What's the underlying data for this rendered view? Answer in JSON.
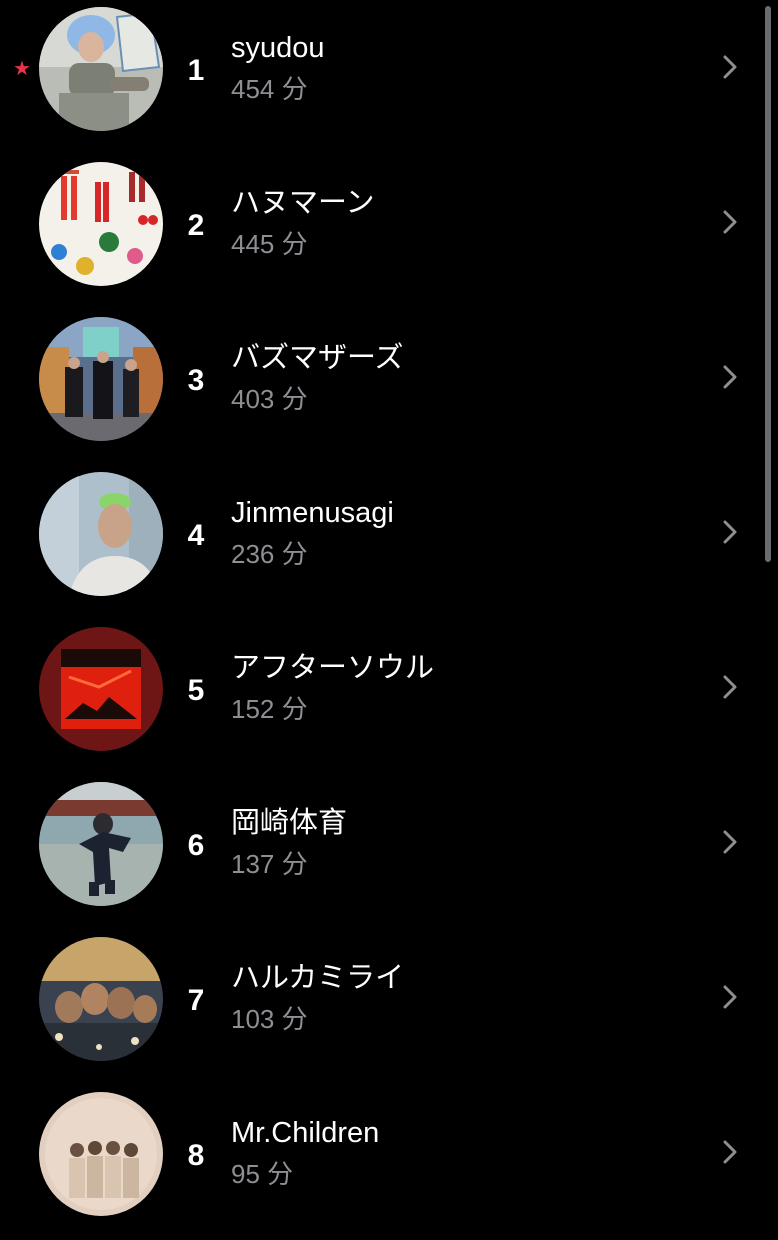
{
  "unit": "分",
  "highlight_color": "#e8334a",
  "rows": [
    {
      "rank": "1",
      "name": "syudou",
      "minutes": "454 分",
      "starred": true,
      "icon": "artist-avatar"
    },
    {
      "rank": "2",
      "name": "ハヌマーン",
      "minutes": "445 分",
      "starred": false,
      "icon": "artist-avatar"
    },
    {
      "rank": "3",
      "name": "バズマザーズ",
      "minutes": "403 分",
      "starred": false,
      "icon": "artist-avatar"
    },
    {
      "rank": "4",
      "name": "Jinmenusagi",
      "minutes": "236 分",
      "starred": false,
      "icon": "artist-avatar"
    },
    {
      "rank": "5",
      "name": "アフターソウル",
      "minutes": "152 分",
      "starred": false,
      "icon": "artist-avatar"
    },
    {
      "rank": "6",
      "name": "岡崎体育",
      "minutes": "137 分",
      "starred": false,
      "icon": "artist-avatar"
    },
    {
      "rank": "7",
      "name": "ハルカミライ",
      "minutes": "103 分",
      "starred": false,
      "icon": "artist-avatar"
    },
    {
      "rank": "8",
      "name": "Mr.Children",
      "minutes": "95 分",
      "starred": false,
      "icon": "artist-avatar"
    }
  ]
}
